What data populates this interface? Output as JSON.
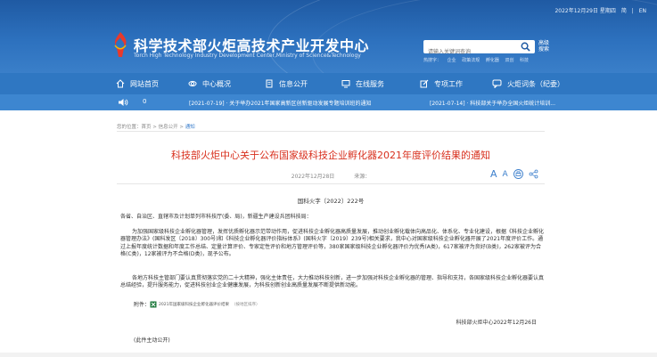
{
  "header": {
    "date_line": "2022年12月29日 星期四",
    "lang_cn": "简",
    "lang_sep": "|",
    "lang_en": "EN",
    "site_title": "科学技术部火炬高技术产业开发中心",
    "site_subtitle": "Torch High Technology Industry Development Center,Ministry of Science&Technology",
    "search_placeholder": "请输入关键词查询",
    "advanced_search": "高级搜索",
    "hot_words": [
      "热搜字：",
      "企业",
      "政策法规",
      "孵化器",
      "双创",
      "科技"
    ]
  },
  "nav": {
    "items": [
      {
        "label": "网站首页",
        "icon": "home-icon"
      },
      {
        "label": "中心概况",
        "icon": "ring-icon"
      },
      {
        "label": "信息公开",
        "icon": "document-icon"
      },
      {
        "label": "在线服务",
        "icon": "monitor-icon"
      },
      {
        "label": "专项工作",
        "icon": "edit-icon"
      },
      {
        "label": "火炬词条（纪委）",
        "icon": "chat-icon"
      }
    ]
  },
  "ticker": {
    "count": "0",
    "item1": "[2021-07-19] · 关于举办2021年国家高新区创新驱动发展专题培训班的通知",
    "item2": "[2021-07-14] · 科技部关于举办全国火炬统计培训..."
  },
  "breadcrumb": {
    "prefix": "您的位置：",
    "home": "首页",
    "sep1": " > ",
    "section": "信息公开",
    "sep2": " > ",
    "current": "通知"
  },
  "article": {
    "title": "科技部火炬中心关于公布国家级科技企业孵化器2021年度评价结果的通知",
    "date": "2022年12月28日",
    "source_label": "来源：",
    "doc_number": "国科火字〔2022〕222号",
    "salutation": "各省、自治区、直辖市及计划单列市科技厅(委、局)，新疆生产建设兵团科技局：",
    "paragraph1": "为加强国家级科技企业孵化器管理，发挥优质孵化器示范带动作用，促进科技企业孵化器高质量发展，推动创业孵化载体向高品化、体系化、专业化建设，根据《科技企业孵化器管理办法》(国科发区〔2018〕300号)和《科技企业孵化器评价指标体系》(国科火字〔2019〕239号)相关要求，我中心对国家级科技企业孵化器开展了2021年度评价工作。通过上报年度统计数据和年度工作总结、定量计算评价、专家定性评价和地方管理评价等，380家国家级科技企业孵化器评价为优秀(A类)，617家被评为良好(B类)，262家被评为合格(C类)，12家被评为不合格(D类)，现予公布。",
    "paragraph2": "各地方科技主管部门要认真贯彻落实党的二十大精神，强化主体责任，大力推动科技创新，进一步加强对科技企业孵化器的管理、指导和支持，各国家级科技企业孵化器要认真总结经验，提升服务能力，促进科技创业企业健康发展，为科技创新创业高质量发展不断提供新动能。",
    "attachment_label": "附件：",
    "attachment_link": "2021年国家级科技企业孵化器评价结果",
    "attachment_note": "（按地区排序）",
    "signature": "科技部火炬中心2022年12月26日",
    "note": "(此件主动公开)"
  },
  "colors": {
    "header_blue": "#2d71be",
    "nav_blue": "#2f77c2",
    "ticker_blue": "#3d86d0",
    "title_red": "#d8301e",
    "link_blue": "#3c7fcc"
  }
}
